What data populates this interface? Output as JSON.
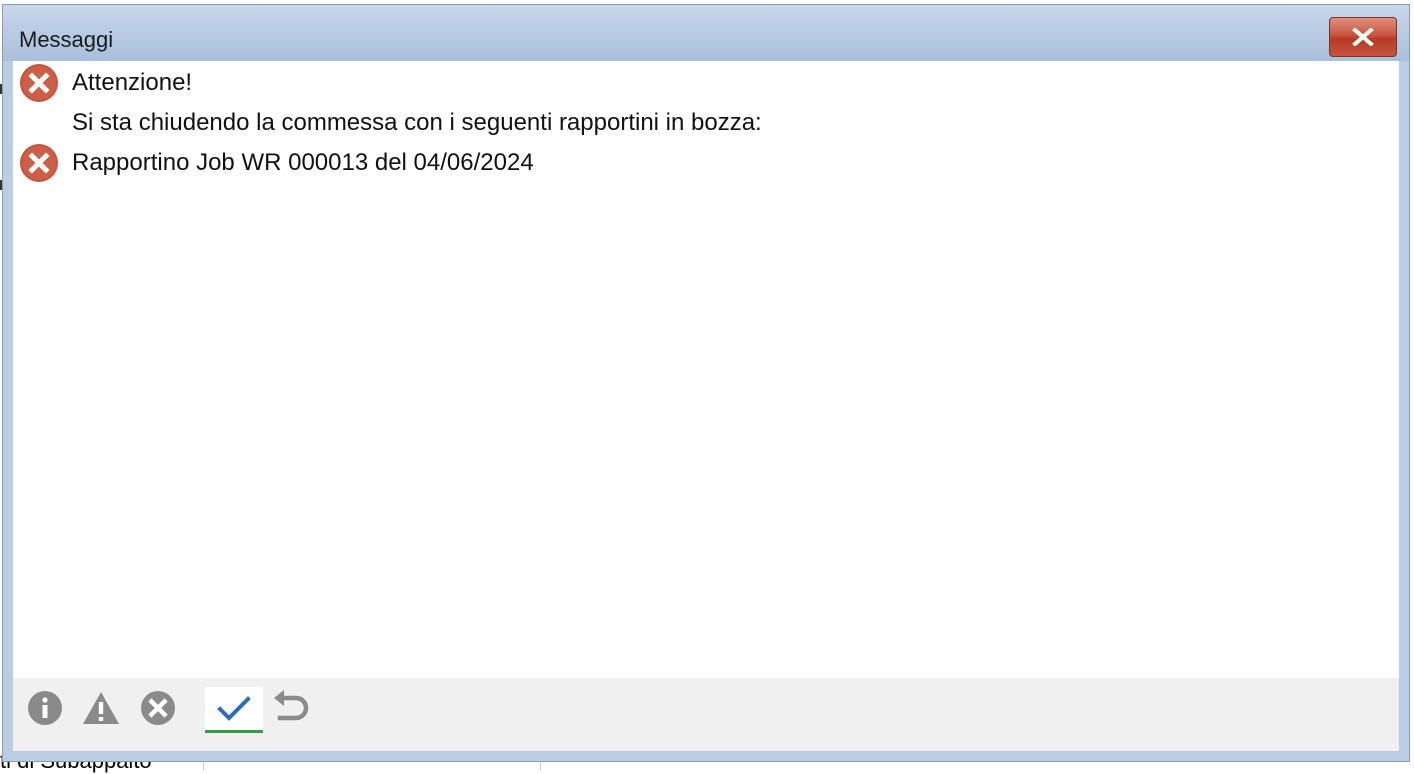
{
  "window": {
    "title": "Messaggi"
  },
  "messages": [
    {
      "icon": "error-icon",
      "text": "Attenzione!"
    },
    {
      "icon": null,
      "text": "Si sta chiudendo la commessa con i seguenti rapportini in bozza:"
    },
    {
      "icon": "error-icon",
      "text": "Rapportino Job WR 000013 del 04/06/2024"
    }
  ],
  "toolbar": {
    "buttons": [
      {
        "icon": "info-icon",
        "active": false
      },
      {
        "icon": "warning-icon",
        "active": false
      },
      {
        "icon": "error-filter-icon",
        "active": false
      },
      {
        "icon": "checkmark-icon",
        "active": true
      },
      {
        "icon": "undo-icon",
        "active": false
      }
    ]
  },
  "background": {
    "partial_text": "ti di Subappalto"
  },
  "colors": {
    "error_red": "#c4553d",
    "titlebar": "#b9cde5",
    "close_button": "#c24a35",
    "check_blue": "#2a6fbf",
    "active_underline": "#3a9a45",
    "toolbar_gray_icon": "#8a8a8a"
  }
}
